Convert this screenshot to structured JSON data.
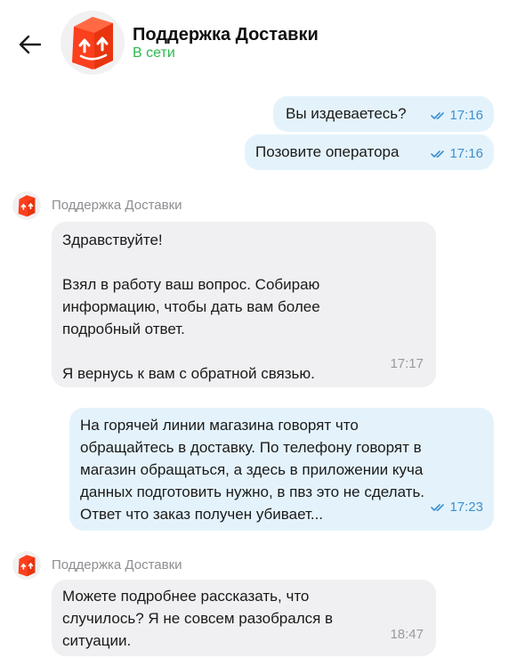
{
  "header": {
    "title": "Поддержка Доставки",
    "status": "В сети"
  },
  "messages": [
    {
      "text": "Вы издеваетесь?",
      "time": "17:16"
    },
    {
      "text": "Позовите оператора",
      "time": "17:16"
    },
    {
      "sender": "Поддержка Доставки",
      "text": "Здравствуйте!\n\nВзял в работу ваш вопрос. Собираю\nинформацию, чтобы дать вам более\nподробный ответ.\n\nЯ вернусь к вам с обратной связью.",
      "time": "17:17"
    },
    {
      "text": "На горячей линии магазина говорят что\nобращайтесь в доставку. По телефону говорят в\nмагазин обращаться, а здесь в приложении куча\nданных подготовить нужно, в пвз это не сделать.\nОтвет что заказ получен убивает...",
      "time": "17:23"
    },
    {
      "sender": "Поддержка Доставки",
      "text": "Можете подробнее рассказать, что\nслучилось? Я не совсем разобрался в\nситуации.",
      "time": "18:47"
    }
  ],
  "colors": {
    "brand_orange": "#fc3f1d",
    "online_green": "#2db84b",
    "outgoing_bubble": "#e4f3fb",
    "incoming_bubble": "#f0f0f2",
    "read_check": "#3f8fce"
  }
}
